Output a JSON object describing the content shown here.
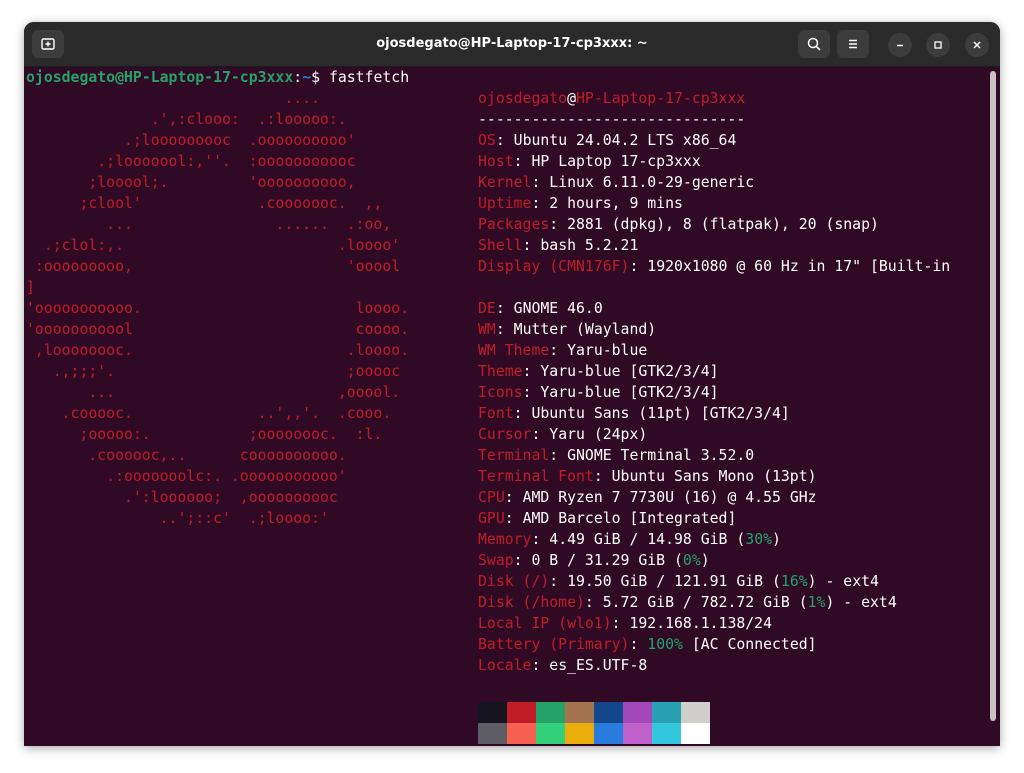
{
  "window": {
    "title": "ojosdegato@HP-Laptop-17-cp3xxx: ~"
  },
  "prompt": {
    "user_host": "ojosdegato@HP-Laptop-17-cp3xxx",
    "colon": ":",
    "path": "~",
    "dollar": "$ ",
    "command": "fastfetch"
  },
  "ascii_logo": [
    "                             ....",
    "              .',:clooo:  .:looooo:.",
    "           .;looooooooc  .oooooooooo'",
    "        .;looooool:,''.  :ooooooooooc",
    "       ;looool;.         'oooooooooo,",
    "      ;clool'             .cooooooc.  ,,",
    "         ...                ......  .:oo,",
    "  .;clol:,.                        .loooo'",
    " :ooooooooo,                        'ooool",
    "]",
    "'ooooooooooo.                        loooo.",
    "'ooooooooool                         coooo.",
    " ,loooooooc.                        .loooo.",
    "   .,;;;'.                          ;ooooc",
    "       ...                         ,ooool.",
    "    .cooooc.              ..',,'.  .cooo.",
    "      ;ooooo:.           ;oooooooc.  :l.",
    "       .coooooc,..      coooooooooo.",
    "         .:ooooooolc:. .ooooooooooo'",
    "           .':loooooo;  ,oooooooooc",
    "               ..';::c'  .;loooo:'"
  ],
  "info": {
    "user": "ojosdegato",
    "at": "@",
    "host": "HP-Laptop-17-cp3xxx",
    "separator": "------------------------------",
    "rows": [
      {
        "key": "OS",
        "value": "Ubuntu 24.04.2 LTS x86_64"
      },
      {
        "key": "Host",
        "value": "HP Laptop 17-cp3xxx"
      },
      {
        "key": "Kernel",
        "value": "Linux 6.11.0-29-generic"
      },
      {
        "key": "Uptime",
        "value": "2 hours, 9 mins"
      },
      {
        "key": "Packages",
        "value": "2881 (dpkg), 8 (flatpak), 20 (snap)"
      },
      {
        "key": "Shell",
        "value": "bash 5.2.21"
      },
      {
        "key": "Display (CMN176F)",
        "value": "1920x1080 @ 60 Hz in 17\" [Built-in"
      },
      {
        "key": "DE",
        "value": "GNOME 46.0"
      },
      {
        "key": "WM",
        "value": "Mutter (Wayland)"
      },
      {
        "key": "WM Theme",
        "value": "Yaru-blue"
      },
      {
        "key": "Theme",
        "value": "Yaru-blue [GTK2/3/4]"
      },
      {
        "key": "Icons",
        "value": "Yaru-blue [GTK2/3/4]"
      },
      {
        "key": "Font",
        "value": "Ubuntu Sans (11pt) [GTK2/3/4]"
      },
      {
        "key": "Cursor",
        "value": "Yaru (24px)"
      },
      {
        "key": "Terminal",
        "value": "GNOME Terminal 3.52.0"
      },
      {
        "key": "Terminal Font",
        "value": "Ubuntu Sans Mono (13pt)"
      },
      {
        "key": "CPU",
        "value": "AMD Ryzen 7 7730U (16) @ 4.55 GHz"
      },
      {
        "key": "GPU",
        "value": "AMD Barcelo [Integrated]"
      },
      {
        "key": "Memory",
        "value": "4.49 GiB / 14.98 GiB (",
        "pct": "30%",
        "suffix": ")"
      },
      {
        "key": "Swap",
        "value": "0 B / 31.29 GiB (",
        "pct": "0%",
        "suffix": ")"
      },
      {
        "key": "Disk (/)",
        "value": "19.50 GiB / 121.91 GiB (",
        "pct": "16%",
        "suffix": ") - ext4"
      },
      {
        "key": "Disk (/home)",
        "value": "5.72 GiB / 782.72 GiB (",
        "pct": "1%",
        "suffix": ") - ext4"
      },
      {
        "key": "Local IP (wlo1)",
        "value": "192.168.1.138/24"
      },
      {
        "key": "Battery (Primary)",
        "value": "",
        "pct": "100%",
        "suffix": " [AC Connected]"
      },
      {
        "key": "Locale",
        "value": "es_ES.UTF-8"
      }
    ],
    "key_suffix": ": "
  },
  "palette": {
    "top": [
      "#171421",
      "#c01c28",
      "#26a269",
      "#a2734c",
      "#12488b",
      "#a347ba",
      "#2aa1b3",
      "#d0cfcc"
    ],
    "bottom": [
      "#5e5c64",
      "#f66151",
      "#33d17a",
      "#e9ad0c",
      "#2a7bde",
      "#c061cb",
      "#33c7de",
      "#ffffff"
    ]
  },
  "icons": {
    "new_tab": "new-tab-icon",
    "search": "search-icon",
    "menu": "hamburger-menu-icon",
    "minimize": "minimize-icon",
    "maximize": "maximize-icon",
    "close": "close-icon"
  }
}
